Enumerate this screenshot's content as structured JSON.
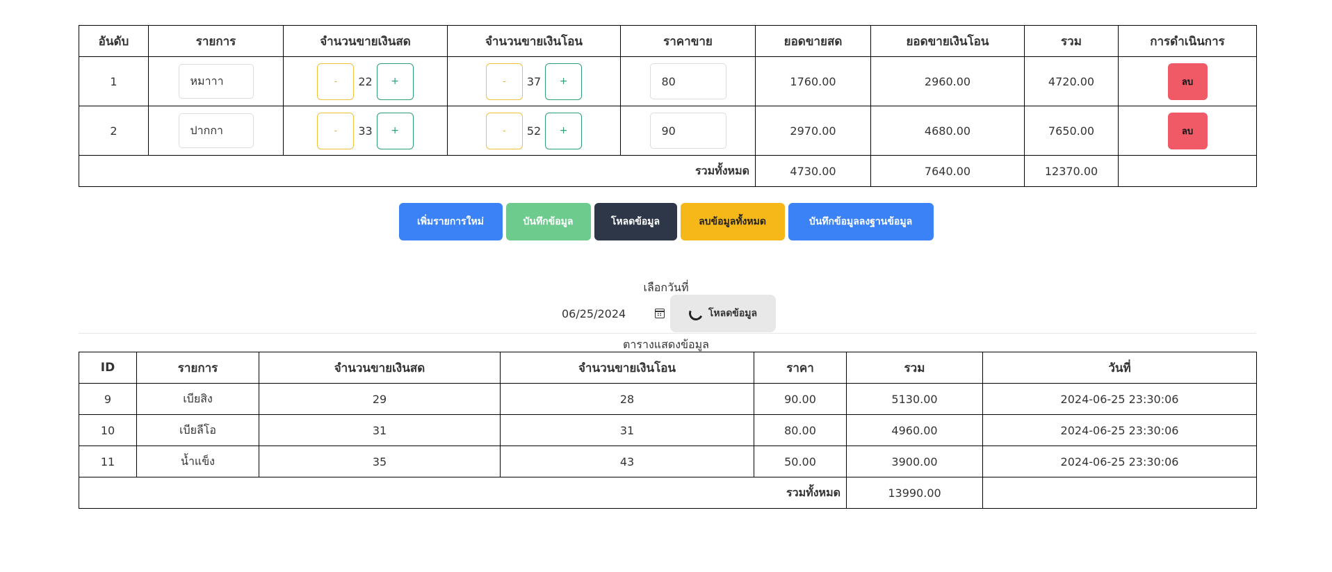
{
  "top_table": {
    "headers": [
      "อันดับ",
      "รายการ",
      "จำนวนขายเงินสด",
      "จำนวนขายเงินโอน",
      "ราคาขาย",
      "ยอดขายสด",
      "ยอดขายเงินโอน",
      "รวม",
      "การดำเนินการ"
    ],
    "rows": [
      {
        "rank": "1",
        "name": "หมาาา",
        "cash_qty": "22",
        "transfer_qty": "37",
        "price": "80",
        "cash_sales": "1760.00",
        "transfer_sales": "2960.00",
        "total": "4720.00",
        "delete_label": "ลบ"
      },
      {
        "rank": "2",
        "name": "ปากกา",
        "cash_qty": "33",
        "transfer_qty": "52",
        "price": "90",
        "cash_sales": "2970.00",
        "transfer_sales": "4680.00",
        "total": "7650.00",
        "delete_label": "ลบ"
      }
    ],
    "minus_label": "-",
    "plus_label": "+",
    "total_label": "รวมทั้งหมด",
    "total_cash": "4730.00",
    "total_transfer": "7640.00",
    "grand_total": "12370.00"
  },
  "actions": {
    "add": "เพิ่มรายการใหม่",
    "save": "บันทึกข้อมูล",
    "load": "โหลดข้อมูล",
    "clear": "ลบข้อมูลทั้งหมด",
    "save_db": "บันทึกข้อมูลลงฐานข้อมูล"
  },
  "date_section": {
    "label": "เลือกวันที่",
    "date_value": "06/25/2024",
    "load_button": "โหลดข้อมูล",
    "icons": [
      "calendar-icon",
      "spinner-icon"
    ]
  },
  "bottom_table": {
    "caption": "ตารางแสดงข้อมูล",
    "headers": [
      "ID",
      "รายการ",
      "จำนวนขายเงินสด",
      "จำนวนขายเงินโอน",
      "ราคา",
      "รวม",
      "วันที่"
    ],
    "rows": [
      {
        "id": "9",
        "name": "เบียสิง",
        "cash_qty": "29",
        "transfer_qty": "28",
        "price": "90.00",
        "total": "5130.00",
        "date": "2024-06-25 23:30:06"
      },
      {
        "id": "10",
        "name": "เบียลีโอ",
        "cash_qty": "31",
        "transfer_qty": "31",
        "price": "80.00",
        "total": "4960.00",
        "date": "2024-06-25 23:30:06"
      },
      {
        "id": "11",
        "name": "น้ำแข็ง",
        "cash_qty": "35",
        "transfer_qty": "43",
        "price": "50.00",
        "total": "3900.00",
        "date": "2024-06-25 23:30:06"
      }
    ],
    "total_label": "รวมทั้งหมด",
    "grand_total": "13990.00"
  },
  "colors": {
    "primary": "#3b82f6",
    "success": "#6ccb8d",
    "dark": "#2d3748",
    "warning": "#f6b818",
    "danger": "#f05a66"
  }
}
